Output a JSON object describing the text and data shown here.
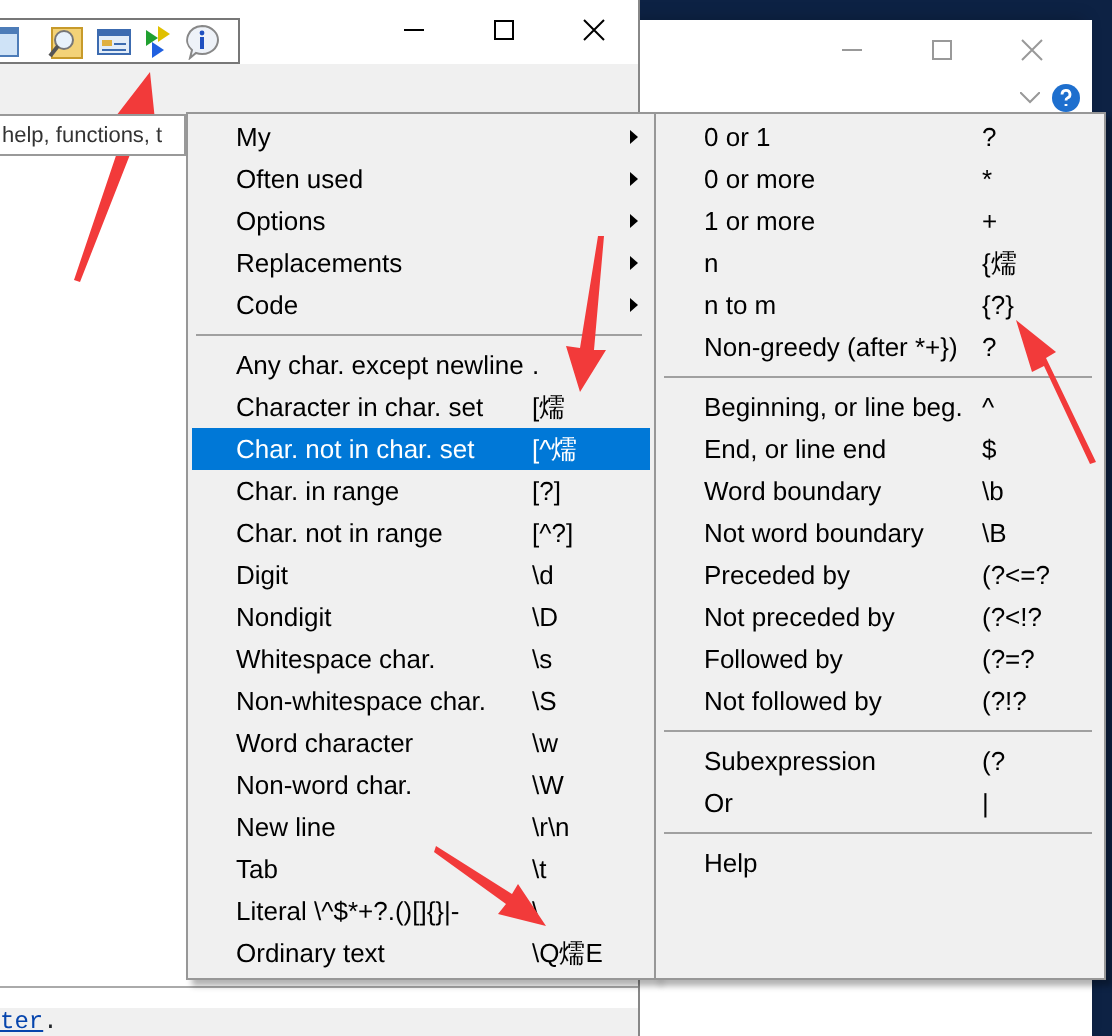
{
  "main_window": {
    "search_field": {
      "value": "help, functions, t"
    },
    "status": {
      "link": "ter",
      "text": "."
    }
  },
  "menu": {
    "items": [
      {
        "kind": "submenu",
        "label": "My",
        "selected": false
      },
      {
        "kind": "submenu",
        "label": "Often used",
        "selected": false
      },
      {
        "kind": "submenu",
        "label": "Options",
        "selected": false
      },
      {
        "kind": "submenu",
        "label": "Replacements",
        "selected": false
      },
      {
        "kind": "submenu",
        "label": "Code",
        "selected": false
      },
      {
        "kind": "separator"
      },
      {
        "kind": "item",
        "label": "Any char. except newline",
        "shortcut": ".",
        "selected": false
      },
      {
        "kind": "item",
        "label": "Character in char. set",
        "shortcut": "[燸",
        "selected": false
      },
      {
        "kind": "item",
        "label": "Char. not in char. set",
        "shortcut": "[^燸",
        "selected": true
      },
      {
        "kind": "item",
        "label": "Char. in range",
        "shortcut": "[?]",
        "selected": false
      },
      {
        "kind": "item",
        "label": "Char. not in range",
        "shortcut": "[^?]",
        "selected": false
      },
      {
        "kind": "item",
        "label": "Digit",
        "shortcut": "\\d",
        "selected": false
      },
      {
        "kind": "item",
        "label": "Nondigit",
        "shortcut": "\\D",
        "selected": false
      },
      {
        "kind": "item",
        "label": "Whitespace char.",
        "shortcut": "\\s",
        "selected": false
      },
      {
        "kind": "item",
        "label": "Non-whitespace char.",
        "shortcut": "\\S",
        "selected": false
      },
      {
        "kind": "item",
        "label": "Word character",
        "shortcut": "\\w",
        "selected": false
      },
      {
        "kind": "item",
        "label": "Non-word char.",
        "shortcut": "\\W",
        "selected": false
      },
      {
        "kind": "item",
        "label": "New line",
        "shortcut": "\\r\\n",
        "selected": false
      },
      {
        "kind": "item",
        "label": "Tab",
        "shortcut": "\\t",
        "selected": false
      },
      {
        "kind": "item",
        "label": "Literal \\^$*+?.()[]{}|-",
        "shortcut": "\\",
        "selected": false
      },
      {
        "kind": "item",
        "label": "Ordinary text",
        "shortcut": "\\Q燸E",
        "selected": false
      }
    ]
  },
  "submenu": {
    "items": [
      {
        "kind": "item",
        "label": "0 or 1",
        "shortcut": "?",
        "selected": false
      },
      {
        "kind": "item",
        "label": "0 or more",
        "shortcut": "*",
        "selected": false
      },
      {
        "kind": "item",
        "label": "1 or more",
        "shortcut": "+",
        "selected": false
      },
      {
        "kind": "item",
        "label": "n",
        "shortcut": "{燸",
        "selected": false
      },
      {
        "kind": "item",
        "label": "n to m",
        "shortcut": "{?}",
        "selected": false
      },
      {
        "kind": "item",
        "label": "Non-greedy (after *+})",
        "shortcut": "?",
        "selected": false
      },
      {
        "kind": "separator"
      },
      {
        "kind": "item",
        "label": "Beginning, or line beg.",
        "shortcut": "^",
        "selected": false
      },
      {
        "kind": "item",
        "label": "End, or line end",
        "shortcut": "$",
        "selected": false
      },
      {
        "kind": "item",
        "label": "Word boundary",
        "shortcut": "\\b",
        "selected": false
      },
      {
        "kind": "item",
        "label": "Not word boundary",
        "shortcut": "\\B",
        "selected": false
      },
      {
        "kind": "item",
        "label": "Preceded by",
        "shortcut": "(?<=?",
        "selected": false
      },
      {
        "kind": "item",
        "label": "Not preceded by",
        "shortcut": "(?<!?",
        "selected": false
      },
      {
        "kind": "item",
        "label": "Followed by",
        "shortcut": "(?=?",
        "selected": false
      },
      {
        "kind": "item",
        "label": "Not followed by",
        "shortcut": "(?!?",
        "selected": false
      },
      {
        "kind": "separator"
      },
      {
        "kind": "item",
        "label": "Subexpression",
        "shortcut": "(?",
        "selected": false
      },
      {
        "kind": "item",
        "label": "Or",
        "shortcut": "|",
        "selected": false
      },
      {
        "kind": "separator"
      },
      {
        "kind": "item",
        "label": "Help",
        "selected": false
      }
    ]
  }
}
